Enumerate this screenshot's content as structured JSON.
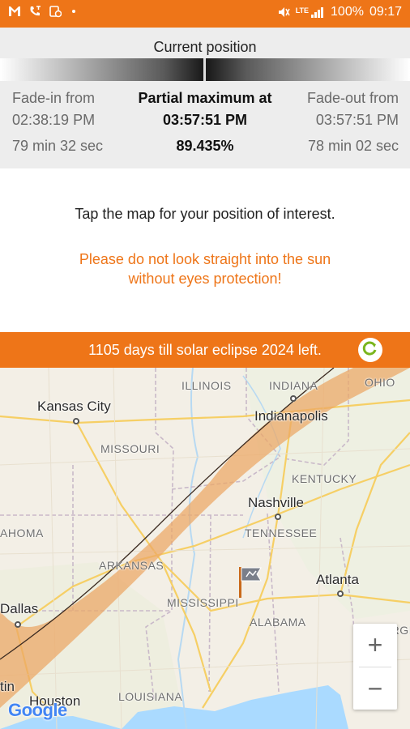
{
  "status_bar": {
    "left_icons": [
      "gmail-icon",
      "missed-call-icon",
      "screenshot-icon",
      "notification-dot-icon"
    ],
    "right_icons": [
      "mute-icon",
      "lte-signal-icon"
    ],
    "lte": "LTE",
    "battery": "100%",
    "time": "09:17"
  },
  "info": {
    "title": "Current position",
    "fade_in_label": "Fade-in from",
    "fade_in_time": "02:38:19 PM",
    "fade_in_duration": "79 min 32 sec",
    "max_label": "Partial maximum at",
    "max_time": "03:57:51 PM",
    "max_percent": "89.435%",
    "fade_out_label": "Fade-out from",
    "fade_out_time": "03:57:51 PM",
    "fade_out_duration": "78 min 02 sec"
  },
  "message": {
    "tap": "Tap the map for your position of interest.",
    "warning_line1": "Please do not look straight into the sun",
    "warning_line2": "without eyes protection!"
  },
  "countdown": {
    "text": "1105 days till solar eclipse 2024 left.",
    "refresh_icon": "refresh-icon"
  },
  "map": {
    "states": {
      "illinois": "ILLINOIS",
      "indiana": "INDIANA",
      "ohio": "OHIO",
      "missouri": "MISSOURI",
      "kentucky": "KENTUCKY",
      "oklahoma": "AHOMA",
      "tennessee": "TENNESSEE",
      "arkansas": "ARKANSAS",
      "mississippi": "MISSISSIPPI",
      "alabama": "ALABAMA",
      "georgia": "GEORGIA",
      "louisiana": "LOUISIANA"
    },
    "cities": {
      "kansas_city": "Kansas City",
      "indianapolis": "Indianapolis",
      "nashville": "Nashville",
      "atlanta": "Atlanta",
      "dallas": "Dallas",
      "houston": "Houston",
      "austin": "tin"
    },
    "marker_icon": "flag-marker-icon",
    "zoom_in": "+",
    "zoom_out": "−",
    "attribution": "Google",
    "colors": {
      "accent": "#ee7518",
      "eclipse_band": "#eba664",
      "water": "#aadaff",
      "land": "#f3efe6"
    }
  }
}
